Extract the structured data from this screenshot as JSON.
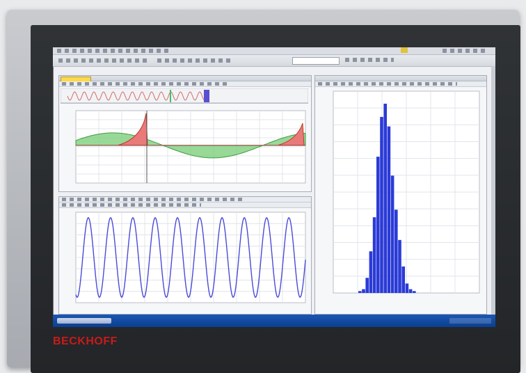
{
  "brand": {
    "logo_text": "BECKHOFF"
  },
  "colors": {
    "brand_red": "#c81b1b",
    "signal_blue": "#4a4ad8",
    "histogram_blue": "#2b3bd6",
    "fill_red": "#e87a7a",
    "fill_green": "#7ed07e",
    "active_tab_yellow": "#ffd949",
    "taskbar_blue": "#1a57b5"
  },
  "scene": {
    "panels": [
      "timeline",
      "band-plot",
      "sine-plot",
      "histogram"
    ]
  },
  "icons": [
    "menu-icon",
    "toolbar-icons",
    "search-field",
    "cursor-marker"
  ]
}
